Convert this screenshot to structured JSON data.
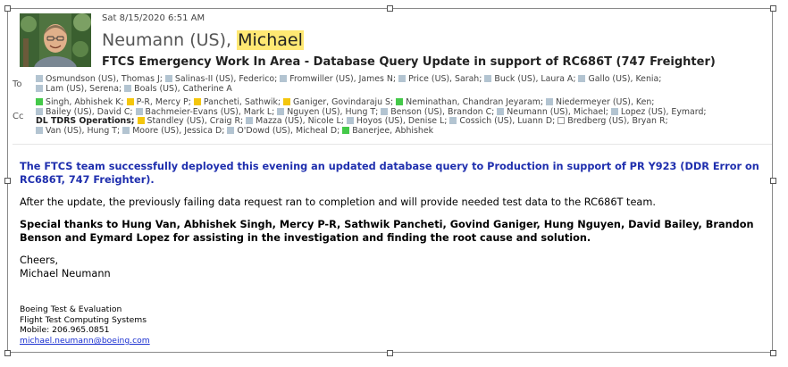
{
  "header": {
    "date": "Sat 8/15/2020 6:51 AM",
    "sender_prefix": "Neumann (US), ",
    "sender_highlight": "Michael",
    "subject": "FTCS Emergency Work In Area -  Database Query Update in support of RC686T (747 Freighter)"
  },
  "to": {
    "label": "To",
    "recipients": [
      "Osmundson (US), Thomas J;",
      "Salinas-II (US), Federico;",
      "Fromwiller (US), James N;",
      "Price (US), Sarah;",
      "Buck (US), Laura A;",
      "Gallo (US), Kenia;",
      "Lam (US), Serena;",
      "Boals (US), Catherine A"
    ]
  },
  "cc": {
    "label": "Cc",
    "recipients": [
      "Singh, Abhishek K;",
      "P-R, Mercy P;",
      "Pancheti, Sathwik;",
      "Ganiger, Govindaraju S;",
      "Neminathan, Chandran Jeyaram;",
      "Niedermeyer (US), Ken;",
      "Bailey (US), David C;",
      "Bachmeier-Evans (US), Mark L;",
      "Nguyen (US), Hung T;",
      "Benson (US), Brandon C;",
      "Neumann (US), Michael;",
      "Lopez (US), Eymard;",
      "DL TDRS Operations;",
      "Standley (US), Craig R;",
      "Mazza (US), Nicole L;",
      "Hoyos (US), Denise L;",
      "Cossich (US), Luann D;",
      "Bredberg (US), Bryan R;",
      "Van (US), Hung T;",
      "Moore (US), Jessica D;",
      "O'Dowd (US), Micheal D;",
      "Banerjee, Abhishek"
    ]
  },
  "status_colors": {
    "green": "#45c94a",
    "yellow": "#f4c60d",
    "gray": "#b3c4d1",
    "none": "#ffffff"
  },
  "body": {
    "p1": "The FTCS team successfully deployed this evening an updated database query to Production in support of PR Y923 (DDR Error on RC686T, 747 Freighter).",
    "p2": "After the update, the previously failing data request ran to completion and will provide needed test data to the RC686T team.",
    "p3": "Special thanks to Hung Van, Abhishek Singh, Mercy P-R, Sathwik Pancheti, Govind Ganiger, Hung Nguyen, David Bailey, Brandon Benson and Eymard Lopez for assisting in the investigation and finding the root cause and solution.",
    "closing": "Cheers,",
    "name": "Michael Neumann"
  },
  "signature": {
    "line1": "Boeing Test & Evaluation",
    "line2": "Flight Test Computing Systems",
    "mobile": "Mobile: 206.965.0851",
    "email": "michael.neumann@boeing.com"
  }
}
